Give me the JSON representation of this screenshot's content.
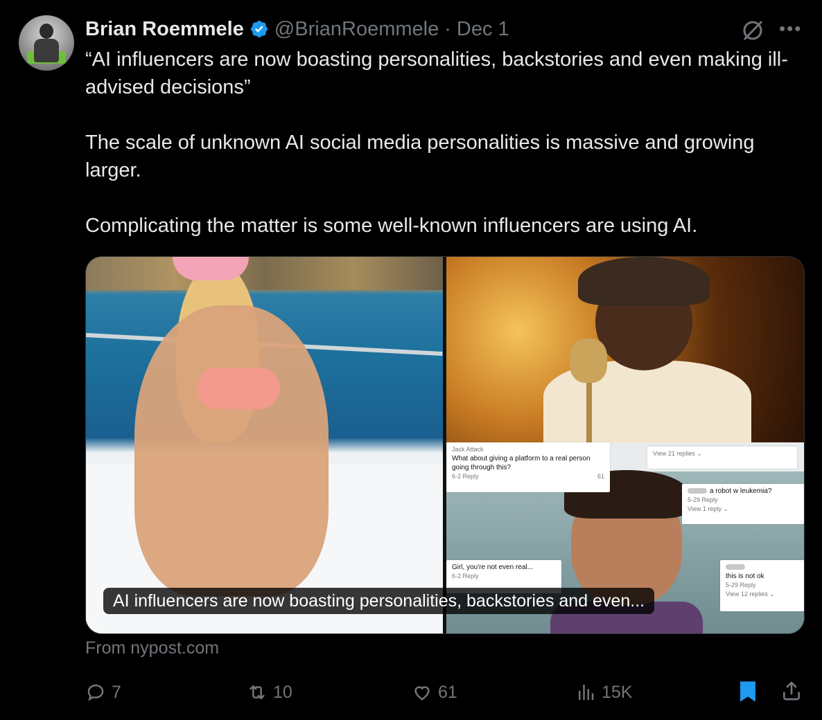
{
  "author": {
    "name": "Brian Roemmele",
    "handle": "@BrianRoemmele",
    "separator": "·",
    "date": "Dec 1"
  },
  "icons": {
    "verified": "verified-badge-icon",
    "grok": "grok-icon",
    "more": "more-icon"
  },
  "tweet": {
    "text": "“AI influencers are now boasting personalities, backstories and even making ill-advised decisions”\n\nThe scale of unknown AI social media personalities is massive and growing larger.\n\nComplicating the matter is some well-known influencers are using AI."
  },
  "media": {
    "caption": "AI influencers are now boasting personalities, backstories and even...",
    "comments": [
      {
        "author": "Jack Attack",
        "text": "What about giving a platform to a real person going through this?",
        "meta": "6-2   Reply",
        "likes": "61"
      },
      {
        "author": "",
        "text": "View 21 replies ⌄",
        "meta": "",
        "likes": ""
      },
      {
        "author": "",
        "text": "a robot w leukemia?",
        "meta": "5-29   Reply",
        "likes": ""
      },
      {
        "author": "",
        "text": "View 1 reply ⌄",
        "meta": "",
        "likes": ""
      },
      {
        "author": "",
        "text": "Girl, you're not even real...",
        "meta": "6-2   Reply",
        "likes": ""
      },
      {
        "author": "",
        "text": "this is not ok",
        "meta": "5-29   Reply",
        "likes": ""
      },
      {
        "author": "",
        "text": "View 12 replies ⌄",
        "meta": "",
        "likes": ""
      }
    ]
  },
  "source": "From nypost.com",
  "actions": {
    "reply_count": "7",
    "retweet_count": "10",
    "like_count": "61",
    "view_count": "15K"
  },
  "colors": {
    "background": "#000000",
    "text": "#e7e9ea",
    "muted": "#71767b",
    "accent": "#1d9bf0"
  }
}
